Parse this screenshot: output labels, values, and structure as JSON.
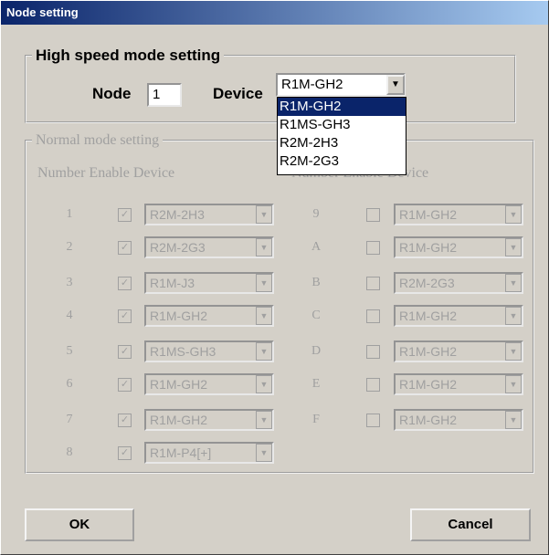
{
  "window": {
    "title": "Node setting"
  },
  "high_speed": {
    "legend": "High speed mode setting",
    "node_label": "Node",
    "node_value": "1",
    "device_label": "Device",
    "device_value": "R1M-GH2",
    "dropdown_open": true,
    "options": [
      "R1M-GH2",
      "R1MS-GH3",
      "R2M-2H3",
      "R2M-2G3"
    ],
    "selected_option": "R1M-GH2"
  },
  "normal": {
    "legend": "Normal mode setting",
    "header_left": "Number Enable Device",
    "header_right": "Number Enable Device",
    "left_rows": [
      {
        "num": "1",
        "enabled": true,
        "device": "R2M-2H3"
      },
      {
        "num": "2",
        "enabled": true,
        "device": "R2M-2G3"
      },
      {
        "num": "3",
        "enabled": true,
        "device": "R1M-J3"
      },
      {
        "num": "4",
        "enabled": true,
        "device": "R1M-GH2"
      },
      {
        "num": "5",
        "enabled": true,
        "device": "R1MS-GH3"
      },
      {
        "num": "6",
        "enabled": true,
        "device": "R1M-GH2"
      },
      {
        "num": "7",
        "enabled": true,
        "device": "R1M-GH2"
      },
      {
        "num": "8",
        "enabled": true,
        "device": "R1M-P4[+]"
      }
    ],
    "right_rows": [
      {
        "num": "9",
        "enabled": false,
        "device": "R1M-GH2"
      },
      {
        "num": "A",
        "enabled": false,
        "device": "R1M-GH2"
      },
      {
        "num": "B",
        "enabled": false,
        "device": "R2M-2G3"
      },
      {
        "num": "C",
        "enabled": false,
        "device": "R1M-GH2"
      },
      {
        "num": "D",
        "enabled": false,
        "device": "R1M-GH2"
      },
      {
        "num": "E",
        "enabled": false,
        "device": "R1M-GH2"
      },
      {
        "num": "F",
        "enabled": false,
        "device": "R1M-GH2"
      }
    ]
  },
  "buttons": {
    "ok": "OK",
    "cancel": "Cancel"
  },
  "colors": {
    "face": "#d4d0c8",
    "title_start": "#0a246a",
    "title_end": "#a6caf0",
    "disabled_text": "#a0a0a0",
    "highlight": "#0a246a"
  }
}
